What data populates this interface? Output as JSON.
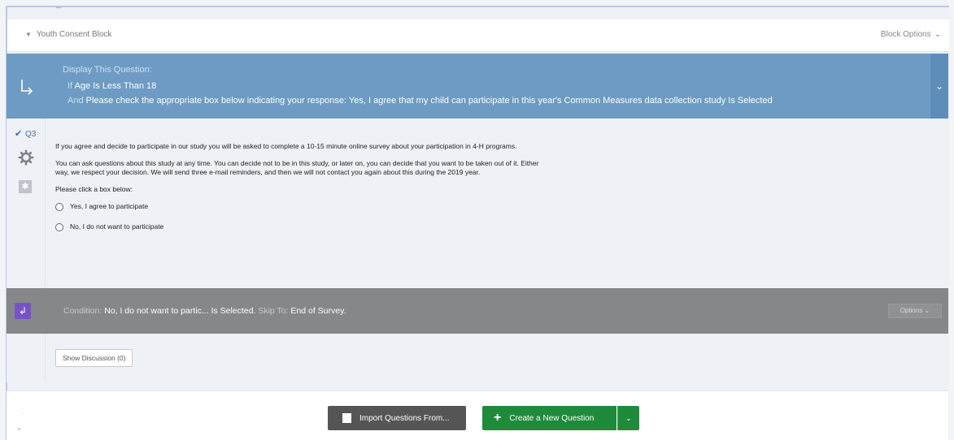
{
  "block": {
    "title": "Youth Consent Block",
    "options_label": "Block Options",
    "options_caret": "⌄"
  },
  "display_logic": {
    "title": "Display This Question:",
    "if_kw": "If",
    "if_text": "Age Is Less Than 18",
    "and_kw": "And",
    "and_text": "Please check the appropriate box below indicating your response: Yes, I agree that my child can participate in this year's Common Measures data collection study Is Selected",
    "collapse_icon": "⌄"
  },
  "question": {
    "id": "Q3",
    "paragraphs": [
      "If you agree and decide to participate in our study you will be asked to complete a 10-15 minute online survey about your participation in 4-H programs.",
      "You can ask questions about this study at any time. You can decide not to be in this study, or later on, you can decide that you want to be taken out of it. Either way, we respect your decision. We will send three e-mail reminders, and then we will not contact you again about this during the 2019 year.",
      "Please click a box below:"
    ],
    "choices": [
      "Yes, I agree to participate",
      "No, I do not want to participate"
    ]
  },
  "skip_logic": {
    "condition_kw": "Condition:",
    "condition_text": "No, I do not want to partic... Is Selected.",
    "skip_kw": "Skip To:",
    "skip_text": "End of Survey.",
    "options_label": "Options ⌄"
  },
  "discussion": {
    "label": "Show Discussion (0)"
  },
  "footer": {
    "import_label": "Import Questions From...",
    "create_label": "Create a New Question",
    "create_caret": "⌄"
  },
  "colors": {
    "display_logic_bg": "#6d9bc3",
    "skip_logic_bg": "#858789",
    "create_btn": "#1e8a3a",
    "import_btn": "#555556"
  }
}
